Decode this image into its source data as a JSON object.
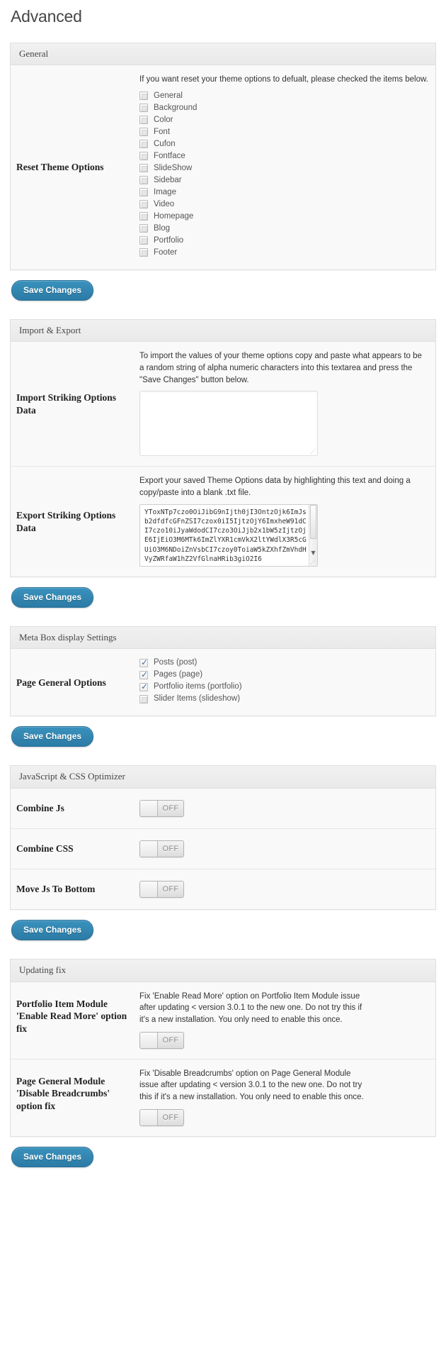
{
  "page": {
    "title": "Advanced"
  },
  "buttons": {
    "save_label": "Save Changes"
  },
  "toggle": {
    "off_label": "OFF"
  },
  "sections": {
    "general": {
      "heading": "General",
      "row_label": "Reset Theme Options",
      "description": "If you want reset your theme options to defualt, please checked the items below.",
      "items": [
        {
          "label": "General",
          "checked": false
        },
        {
          "label": "Background",
          "checked": false
        },
        {
          "label": "Color",
          "checked": false
        },
        {
          "label": "Font",
          "checked": false
        },
        {
          "label": "Cufon",
          "checked": false
        },
        {
          "label": "Fontface",
          "checked": false
        },
        {
          "label": "SlideShow",
          "checked": false
        },
        {
          "label": "Sidebar",
          "checked": false
        },
        {
          "label": "Image",
          "checked": false
        },
        {
          "label": "Video",
          "checked": false
        },
        {
          "label": "Homepage",
          "checked": false
        },
        {
          "label": "Blog",
          "checked": false
        },
        {
          "label": "Portfolio",
          "checked": false
        },
        {
          "label": "Footer",
          "checked": false
        }
      ]
    },
    "import_export": {
      "heading": "Import & Export",
      "import": {
        "row_label": "Import Striking Options Data",
        "description": "To import the values of your theme options copy and paste what appears to be a random string of alpha numeric characters into this textarea and press the \"Save Changes\" button below.",
        "value": ""
      },
      "export": {
        "row_label": "Export Striking Options Data",
        "description": "Export your saved Theme Options data by highlighting this text and doing a copy/paste into a blank .txt file.",
        "value": "YToxNTp7czo0OiJibG9nIjth0jI3OntzOjk6ImJsb2dfdfcGFnZSI7czox0iI5IjtzOjY6ImxheW91dCI7czo10iJyaWdodCI7czo3OiJjb2x1bW5zIjtzOjE6IjEiO3M6MTk6ImZlYXR1cmVkX2ltYWdlX3R5cGUiO3M6NDoiZnVsbCI7czoy0ToiaW5kZXhfZmVhdHVyZWRfaW1hZ2VfGlnaHRib3giO2I6"
      }
    },
    "meta_box": {
      "heading": "Meta Box display Settings",
      "row_label": "Page General Options",
      "items": [
        {
          "label": "Posts (post)",
          "checked": true
        },
        {
          "label": "Pages (page)",
          "checked": true
        },
        {
          "label": "Portfolio items (portfolio)",
          "checked": true
        },
        {
          "label": "Slider Items (slideshow)",
          "checked": false
        }
      ]
    },
    "optimizer": {
      "heading": "JavaScript & CSS Optimizer",
      "rows": [
        {
          "label": "Combine Js",
          "state": "OFF"
        },
        {
          "label": "Combine CSS",
          "state": "OFF"
        },
        {
          "label": "Move Js To Bottom",
          "state": "OFF"
        }
      ]
    },
    "updating_fix": {
      "heading": "Updating fix",
      "rows": [
        {
          "label": "Portfolio Item Module 'Enable Read More' option fix",
          "description": "Fix 'Enable Read More' option on Portfolio Item Module issue after updating < version 3.0.1 to the new one. Do not try this if it's a new installation. You only need to enable this once.",
          "state": "OFF"
        },
        {
          "label": "Page General Module 'Disable Breadcrumbs' option fix",
          "description": "Fix 'Disable Breadcrumbs' option on Page General Module issue after updating < version 3.0.1 to the new one. Do not try this if it's a new installation. You only need to enable this once.",
          "state": "OFF"
        }
      ]
    }
  }
}
